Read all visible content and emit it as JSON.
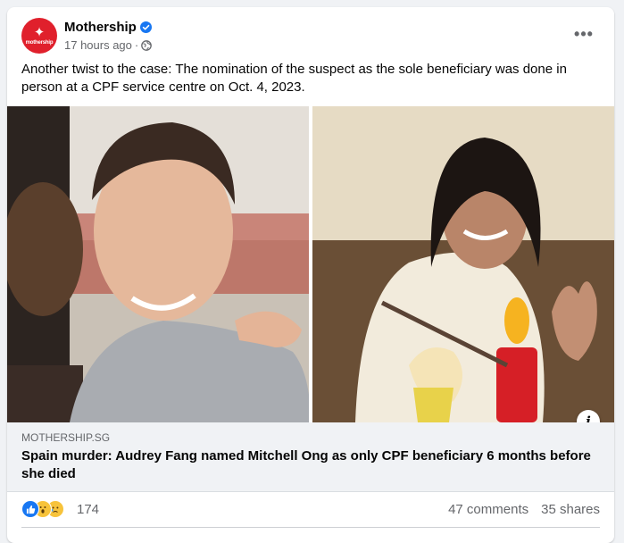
{
  "post": {
    "page_name": "Mothership",
    "time": "17 hours ago",
    "separator": "·",
    "avatar_text": "mothership",
    "text": "Another twist to the case: The nomination of the suspect as the sole beneficiary was done in person at a CPF service centre on Oct. 4, 2023."
  },
  "link": {
    "domain": "MOTHERSHIP.SG",
    "title": "Spain murder: Audrey Fang named Mitchell Ong as only CPF beneficiary 6 months before she died"
  },
  "footer": {
    "reaction_count": "174",
    "comments": "47 comments",
    "shares": "35 shares",
    "reaction_icons": [
      "like-icon",
      "wow-icon",
      "sad-icon"
    ]
  },
  "colors": {
    "brand_red": "#e0202c",
    "facebook_blue": "#1877f2",
    "muted": "#65676b"
  }
}
